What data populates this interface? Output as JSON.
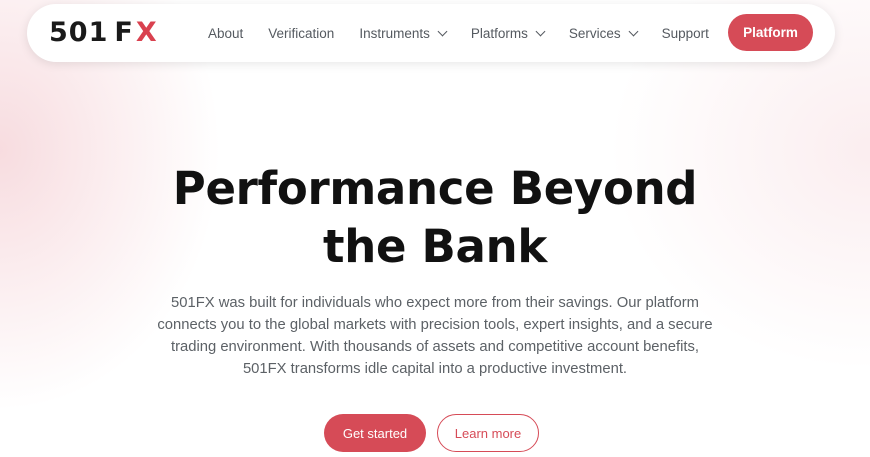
{
  "header": {
    "logo": {
      "number": "501",
      "letter_f": "F",
      "letter_x": "X"
    },
    "nav": [
      {
        "label": "About",
        "has_dropdown": false
      },
      {
        "label": "Verification",
        "has_dropdown": false
      },
      {
        "label": "Instruments",
        "has_dropdown": true
      },
      {
        "label": "Platforms",
        "has_dropdown": true
      },
      {
        "label": "Services",
        "has_dropdown": true
      },
      {
        "label": "Support",
        "has_dropdown": false
      }
    ],
    "platform_button": "Platform"
  },
  "hero": {
    "title_line1": "Performance Beyond",
    "title_line2": "the Bank",
    "description_lines": [
      "501FX was built for individuals who expect more from their savings. Our platform",
      "connects you to the global markets with precision tools, expert insights, and a secure",
      "trading environment. With thousands of assets and competitive account benefits,",
      "501FX transforms idle capital into a productive investment."
    ],
    "primary_button": "Get started",
    "secondary_button": "Learn more"
  },
  "colors": {
    "accent": "#d64b57",
    "logo_x": "#d9414f",
    "nav_text": "#555a60",
    "heading": "#111111",
    "body_text": "#5c6166"
  },
  "icons": {
    "dropdown": "chevron-down-icon"
  }
}
